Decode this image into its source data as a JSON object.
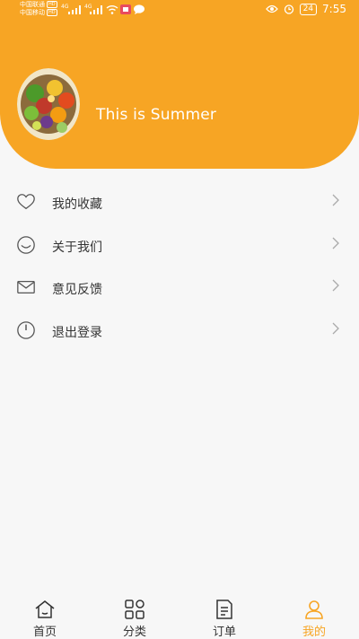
{
  "status_bar": {
    "carrier1": "中国联通",
    "carrier2": "中国移动",
    "hd": "HD",
    "signal_tag": "4G",
    "battery": "24",
    "time": "7:55"
  },
  "profile": {
    "name": "This is Summer",
    "avatar": "fruit-bowl-avatar"
  },
  "menu": [
    {
      "label": "我的收藏",
      "icon": "heart-icon"
    },
    {
      "label": "关于我们",
      "icon": "smile-icon"
    },
    {
      "label": "意见反馈",
      "icon": "mail-icon"
    },
    {
      "label": "退出登录",
      "icon": "power-icon"
    }
  ],
  "tabbar": [
    {
      "label": "首页",
      "icon": "home-icon"
    },
    {
      "label": "分类",
      "icon": "category-icon"
    },
    {
      "label": "订单",
      "icon": "order-icon"
    },
    {
      "label": "我的",
      "icon": "user-icon",
      "active": true
    }
  ],
  "colors": {
    "accent": "#f7a524",
    "background": "#f7f7f7"
  }
}
